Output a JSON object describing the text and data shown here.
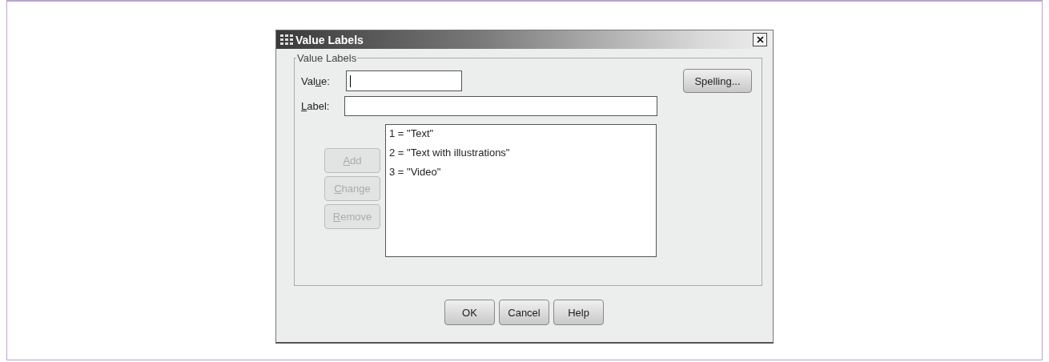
{
  "window": {
    "title": "Value Labels"
  },
  "group": {
    "title": "Value Labels"
  },
  "fields": [
    {
      "before": "Val",
      "mnemonic": "u",
      "after": "e:",
      "focused": true
    },
    {
      "mnemonic": "L",
      "after": "abel:",
      "focused": false
    }
  ],
  "spelling_button": {
    "label": "Spelling..."
  },
  "side_buttons": [
    {
      "mnemonic": "A",
      "after": "dd",
      "disabled": true
    },
    {
      "mnemonic": "C",
      "after": "hange",
      "disabled": true
    },
    {
      "mnemonic": "R",
      "after": "emove",
      "disabled": true
    }
  ],
  "list": {
    "items": [
      "1 = \"Text\"",
      "2 = \"Text with illustrations\"",
      "3 = \"Video\""
    ]
  },
  "buttons": [
    {
      "label": "OK",
      "disabled": false
    },
    {
      "label": "Cancel",
      "disabled": false
    },
    {
      "label": "Help",
      "disabled": false
    }
  ]
}
